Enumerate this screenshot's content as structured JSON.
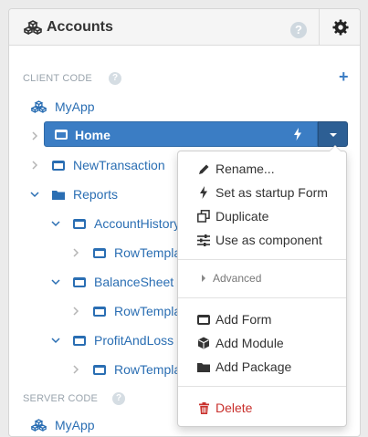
{
  "header": {
    "title": "Accounts",
    "help": "?"
  },
  "client": {
    "label": "CLIENT CODE",
    "help": "?",
    "add": "+",
    "app": "MyApp",
    "items": [
      {
        "label": "Home"
      },
      {
        "label": "NewTransaction"
      },
      {
        "label": "Reports"
      },
      {
        "label": "AccountHistory"
      },
      {
        "label": "RowTemplate"
      },
      {
        "label": "BalanceSheet"
      },
      {
        "label": "RowTemplate"
      },
      {
        "label": "ProfitAndLoss"
      },
      {
        "label": "RowTemplate"
      }
    ]
  },
  "server": {
    "label": "SERVER CODE",
    "help": "?",
    "app": "MyApp"
  },
  "menu": {
    "rename": "Rename...",
    "startup": "Set as startup Form",
    "duplicate": "Duplicate",
    "component": "Use as component",
    "advanced": "Advanced",
    "add_form": "Add Form",
    "add_module": "Add Module",
    "add_package": "Add Package",
    "delete": "Delete"
  },
  "colors": {
    "accent": "#3b7dc4",
    "danger": "#c9302c",
    "link": "#2a6eb3"
  }
}
